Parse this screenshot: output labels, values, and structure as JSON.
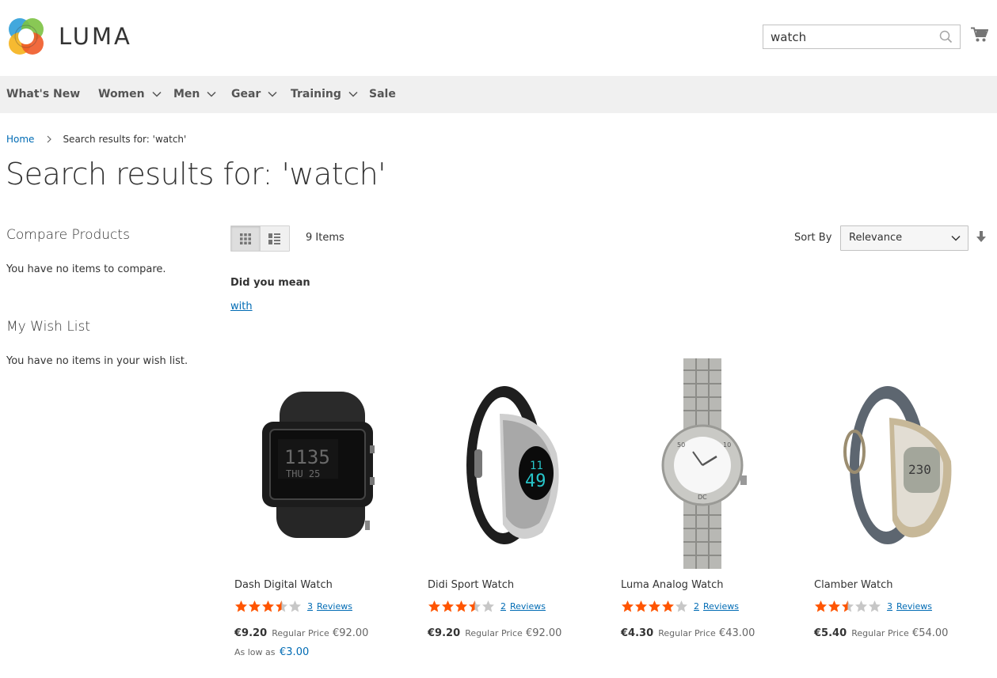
{
  "header": {
    "logo_text": "LUMA",
    "search_value": "watch"
  },
  "nav": {
    "items": [
      {
        "label": "What's New",
        "has_dropdown": false
      },
      {
        "label": "Women",
        "has_dropdown": true
      },
      {
        "label": "Men",
        "has_dropdown": true
      },
      {
        "label": "Gear",
        "has_dropdown": true
      },
      {
        "label": "Training",
        "has_dropdown": true
      },
      {
        "label": "Sale",
        "has_dropdown": false
      }
    ]
  },
  "breadcrumb": {
    "home": "Home",
    "current": "Search results for: 'watch'"
  },
  "page_title": "Search results for: 'watch'",
  "sidebar": {
    "compare_title": "Compare Products",
    "compare_text": "You have no items to compare.",
    "wishlist_title": "My Wish List",
    "wishlist_text": "You have no items in your wish list."
  },
  "toolbar": {
    "items_count": "9 Items",
    "sort_label": "Sort By",
    "sort_value": "Relevance"
  },
  "did_you_mean": {
    "label": "Did you mean",
    "suggestion": "with"
  },
  "products": [
    {
      "name": "Dash Digital Watch",
      "rating": 3.5,
      "reviews_count": "3",
      "reviews_label": "Reviews",
      "price": "€9.20",
      "regular_label": "Regular Price",
      "regular_price": "€92.00",
      "as_low_label": "As low as",
      "as_low_value": "€3.00"
    },
    {
      "name": "Didi Sport Watch",
      "rating": 3.5,
      "reviews_count": "2",
      "reviews_label": "Reviews",
      "price": "€9.20",
      "regular_label": "Regular Price",
      "regular_price": "€92.00"
    },
    {
      "name": "Luma Analog Watch",
      "rating": 4,
      "reviews_count": "2",
      "reviews_label": "Reviews",
      "price": "€4.30",
      "regular_label": "Regular Price",
      "regular_price": "€43.00"
    },
    {
      "name": "Clamber Watch",
      "rating": 2.5,
      "reviews_count": "3",
      "reviews_label": "Reviews",
      "price": "€5.40",
      "regular_label": "Regular Price",
      "regular_price": "€54.00"
    }
  ],
  "colors": {
    "link": "#006bb4",
    "star": "#ff5501",
    "star_empty": "#c7c7c7",
    "nav_bg": "#f0f0f0"
  }
}
